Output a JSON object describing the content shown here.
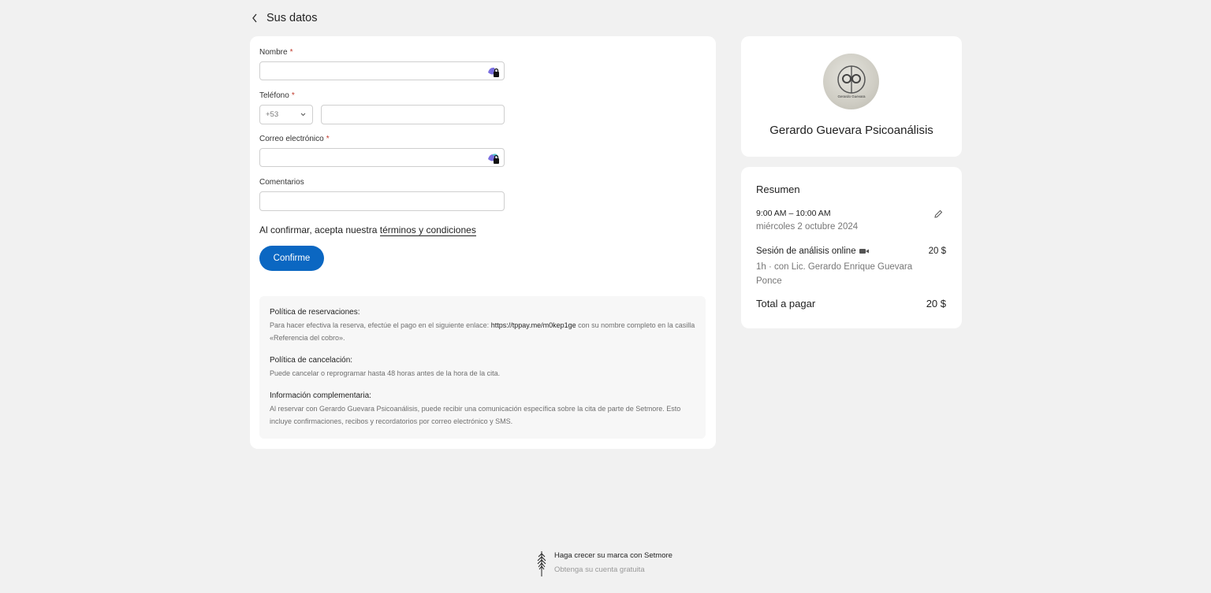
{
  "header": {
    "title": "Sus datos"
  },
  "form": {
    "name_label": "Nombre",
    "phone_label": "Teléfono",
    "country_code": "+53",
    "email_label": "Correo electrónico",
    "comments_label": "Comentarios",
    "required_marker": "*",
    "terms_prefix": "Al confirmar, acepta nuestra",
    "terms_link": "términos y condiciones",
    "confirm_label": "Confirme"
  },
  "policies": [
    {
      "title": "Política de reservaciones:",
      "text_before": "Para hacer efectiva la reserva, efectúe el pago en el siguiente enlace:",
      "link": "https://tppay.me/m0kep1ge",
      "text_after": "con su nombre completo en la casilla «Referencia del cobro»."
    },
    {
      "title": "Política de cancelación:",
      "text": "Puede cancelar o reprogramar hasta 48 horas antes de la hora de la cita."
    },
    {
      "title": "Información complementaria:",
      "text": "Al reservar con Gerardo Guevara Psicoanálisis, puede recibir una comunicación específica sobre la cita de parte de Setmore. Esto incluye confirmaciones, recibos y recordatorios por correo electrónico y SMS."
    }
  ],
  "business": {
    "name": "Gerardo Guevara Psicoanálisis",
    "logo_text": "Gerardo Guevara"
  },
  "summary": {
    "title": "Resumen",
    "time": "9:00 AM – 10:00 AM",
    "date": "miércoles 2 octubre 2024",
    "service_name": "Sesión de análisis online",
    "service_price": "20 $",
    "service_desc": "1h · con Lic. Gerardo Enrique Guevara Ponce",
    "total_label": "Total a pagar",
    "total_value": "20 $"
  },
  "footer": {
    "line1": "Haga crecer su marca con Setmore",
    "line2": "Obtenga su cuenta gratuita"
  },
  "colors": {
    "accent": "#0b67c2",
    "background": "#f1f1f1"
  }
}
